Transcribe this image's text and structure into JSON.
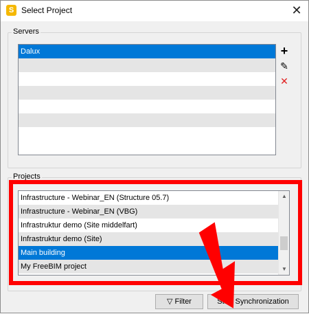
{
  "window": {
    "title": "Select Project",
    "app_icon_letter": "S",
    "close_glyph": "✕"
  },
  "servers": {
    "group_label": "Servers",
    "items": [
      "Dalux",
      "",
      "",
      "",
      "",
      "",
      ""
    ],
    "selected_index": 0,
    "add_glyph": "+",
    "edit_glyph": "✎",
    "remove_glyph": "✕"
  },
  "projects": {
    "group_label": "Projects",
    "items": [
      "Infrastructure - Webinar_EN (Structure 05.7)",
      "Infrastructure - Webinar_EN (VBG)",
      "Infrastruktur demo (Site middelfart)",
      "Infrastruktur demo (Site)",
      "Main building",
      "My FreeBIM project"
    ],
    "selected_index": 4,
    "scroll_position": 0.55
  },
  "buttons": {
    "filter_label": "Filter",
    "start_label": "Start Synchronization"
  },
  "colors": {
    "selection": "#0078d7",
    "annotation": "#ff0000"
  }
}
